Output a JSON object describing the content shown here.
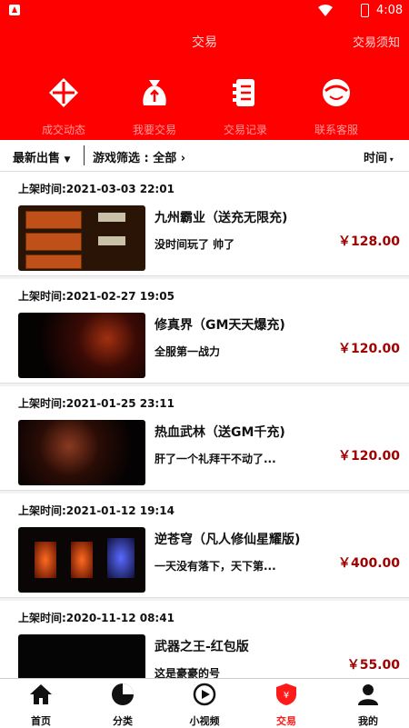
{
  "status": {
    "time": "4:08"
  },
  "header": {
    "title": "交易",
    "notice": "交易须知"
  },
  "quick": [
    {
      "label": "成交动态",
      "icon": "diamond-cross-icon"
    },
    {
      "label": "我要交易",
      "icon": "money-bag-icon"
    },
    {
      "label": "交易记录",
      "icon": "list-document-icon"
    },
    {
      "label": "联系客服",
      "icon": "support-chat-icon"
    }
  ],
  "filters": {
    "sort": "最新出售",
    "game": "游戏筛选 : 全部",
    "time": "时间"
  },
  "listings": [
    {
      "listed": "上架时间:2021-03-03 22:01",
      "title": "九州霸业（送充无限充)",
      "desc": "没时间玩了 帅了",
      "price": "￥128.00"
    },
    {
      "listed": "上架时间:2021-02-27 19:05",
      "title": "修真界（GM天天爆充)",
      "desc": "全服第一战力",
      "price": "￥120.00"
    },
    {
      "listed": "上架时间:2021-01-25 23:11",
      "title": "热血武林（送GM千充)",
      "desc": "肝了一个礼拜干不动了...",
      "price": "￥120.00"
    },
    {
      "listed": "上架时间:2021-01-12 19:14",
      "title": "逆苍穹（凡人修仙星耀版)",
      "desc": "一天没有落下，天下第...",
      "price": "￥400.00"
    },
    {
      "listed": "上架时间:2020-11-12 08:41",
      "title": "武器之王-红包版",
      "desc": "这是豪豪的号",
      "price": "￥55.00"
    }
  ],
  "tabs": [
    {
      "label": "首页",
      "icon": "home-icon"
    },
    {
      "label": "分类",
      "icon": "category-icon"
    },
    {
      "label": "小视频",
      "icon": "play-icon"
    },
    {
      "label": "交易",
      "icon": "trade-shield-icon",
      "active": true
    },
    {
      "label": "我的",
      "icon": "user-icon"
    }
  ],
  "colors": {
    "brand": "#ff0000",
    "price": "#a00000",
    "active_tab": "#ff1a1a"
  }
}
